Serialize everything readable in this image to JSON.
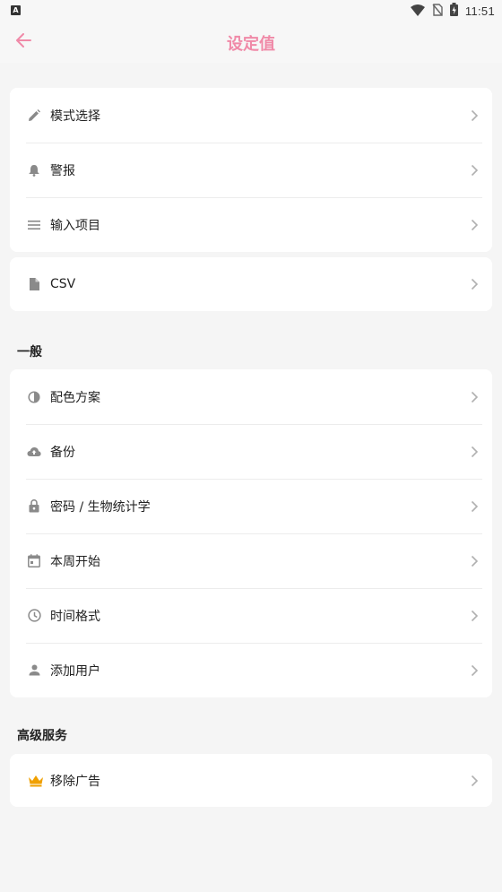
{
  "status_bar": {
    "time": "11:51"
  },
  "header": {
    "title": "设定值"
  },
  "group1": {
    "items": [
      {
        "label": "模式选择",
        "icon": "pencil-icon"
      },
      {
        "label": "警报",
        "icon": "bell-icon"
      },
      {
        "label": "输入项目",
        "icon": "list-icon"
      }
    ]
  },
  "group2": {
    "items": [
      {
        "label": "CSV",
        "icon": "file-icon"
      }
    ]
  },
  "general": {
    "title": "一般",
    "items": [
      {
        "label": "配色方案",
        "icon": "contrast-icon"
      },
      {
        "label": "备份",
        "icon": "cloud-upload-icon"
      },
      {
        "label": "密码 / 生物统计学",
        "icon": "lock-icon"
      },
      {
        "label": "本周开始",
        "icon": "calendar-icon"
      },
      {
        "label": "时间格式",
        "icon": "clock-icon"
      },
      {
        "label": "添加用户",
        "icon": "person-icon"
      }
    ]
  },
  "premium": {
    "title": "高级服务",
    "items": [
      {
        "label": "移除广告",
        "icon": "crown-icon"
      }
    ]
  },
  "colors": {
    "accent": "#f08aa8",
    "icon_gray": "#8a8a8a",
    "crown": "#f0a000"
  }
}
